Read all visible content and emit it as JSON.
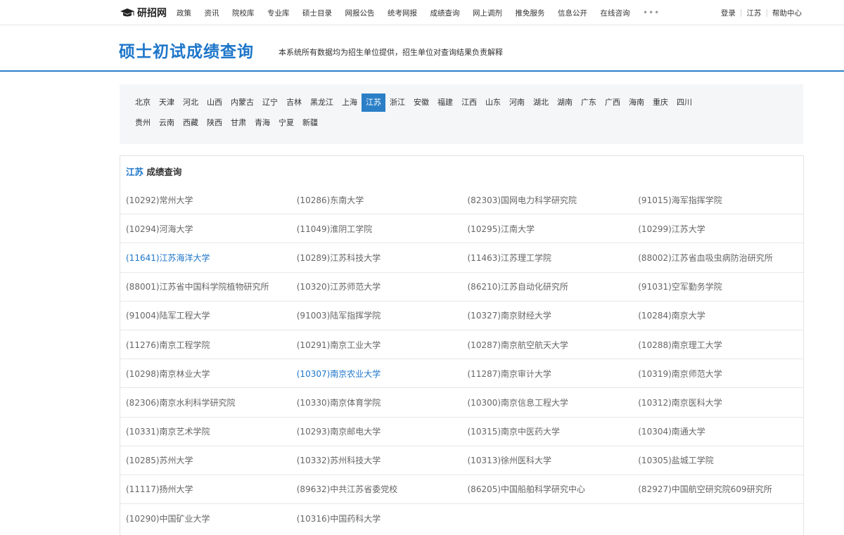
{
  "nav": {
    "logo_text": "研招网",
    "items": [
      "政策",
      "资讯",
      "院校库",
      "专业库",
      "硕士目录",
      "网报公告",
      "统考网报",
      "成绩查询",
      "网上调剂",
      "推免服务",
      "信息公开",
      "在线咨询"
    ],
    "more": "•••",
    "login": "登录",
    "region": "江苏",
    "help": "帮助中心"
  },
  "header": {
    "title": "硕士初试成绩查询",
    "subtitle": "本系统所有数据均为招生单位提供，招生单位对查询结果负责解释"
  },
  "provinces": {
    "row1": [
      "北京",
      "天津",
      "河北",
      "山西",
      "内蒙古",
      "辽宁",
      "吉林",
      "黑龙江",
      "上海",
      "江苏",
      "浙江",
      "安徽",
      "福建",
      "江西",
      "山东",
      "河南",
      "湖北",
      "湖南",
      "广东",
      "广西",
      "海南",
      "重庆",
      "四川"
    ],
    "row2": [
      "贵州",
      "云南",
      "西藏",
      "陕西",
      "甘肃",
      "青海",
      "宁夏",
      "新疆"
    ],
    "active": "江苏"
  },
  "results": {
    "province": "江苏",
    "title_suffix": " 成绩查询",
    "rows": [
      [
        "(10292)常州大学",
        "(10286)东南大学",
        "(82303)国网电力科学研究院",
        "(91015)海军指挥学院"
      ],
      [
        "(10294)河海大学",
        "(11049)淮阴工学院",
        "(10295)江南大学",
        "(10299)江苏大学"
      ],
      [
        "(11641)江苏海洋大学",
        "(10289)江苏科技大学",
        "(11463)江苏理工学院",
        "(88002)江苏省血吸虫病防治研究所"
      ],
      [
        "(88001)江苏省中国科学院植物研究所",
        "(10320)江苏师范大学",
        "(86210)江苏自动化研究所",
        "(91031)空军勤务学院"
      ],
      [
        "(91004)陆军工程大学",
        "(91003)陆军指挥学院",
        "(10327)南京财经大学",
        "(10284)南京大学"
      ],
      [
        "(11276)南京工程学院",
        "(10291)南京工业大学",
        "(10287)南京航空航天大学",
        "(10288)南京理工大学"
      ],
      [
        "(10298)南京林业大学",
        "(10307)南京农业大学",
        "(11287)南京审计大学",
        "(10319)南京师范大学"
      ],
      [
        "(82306)南京水利科学研究院",
        "(10330)南京体育学院",
        "(10300)南京信息工程大学",
        "(10312)南京医科大学"
      ],
      [
        "(10331)南京艺术学院",
        "(10293)南京邮电大学",
        "(10315)南京中医药大学",
        "(10304)南通大学"
      ],
      [
        "(10285)苏州大学",
        "(10332)苏州科技大学",
        "(10313)徐州医科大学",
        "(10305)盐城工学院"
      ],
      [
        "(11117)扬州大学",
        "(89632)中共江苏省委党校",
        "(86205)中国船舶科学研究中心",
        "(82927)中国航空研究院609研究所"
      ],
      [
        "(10290)中国矿业大学",
        "(10316)中国药科大学",
        "",
        ""
      ]
    ],
    "highlighted": [
      "(11641)江苏海洋大学",
      "(10307)南京农业大学"
    ]
  }
}
